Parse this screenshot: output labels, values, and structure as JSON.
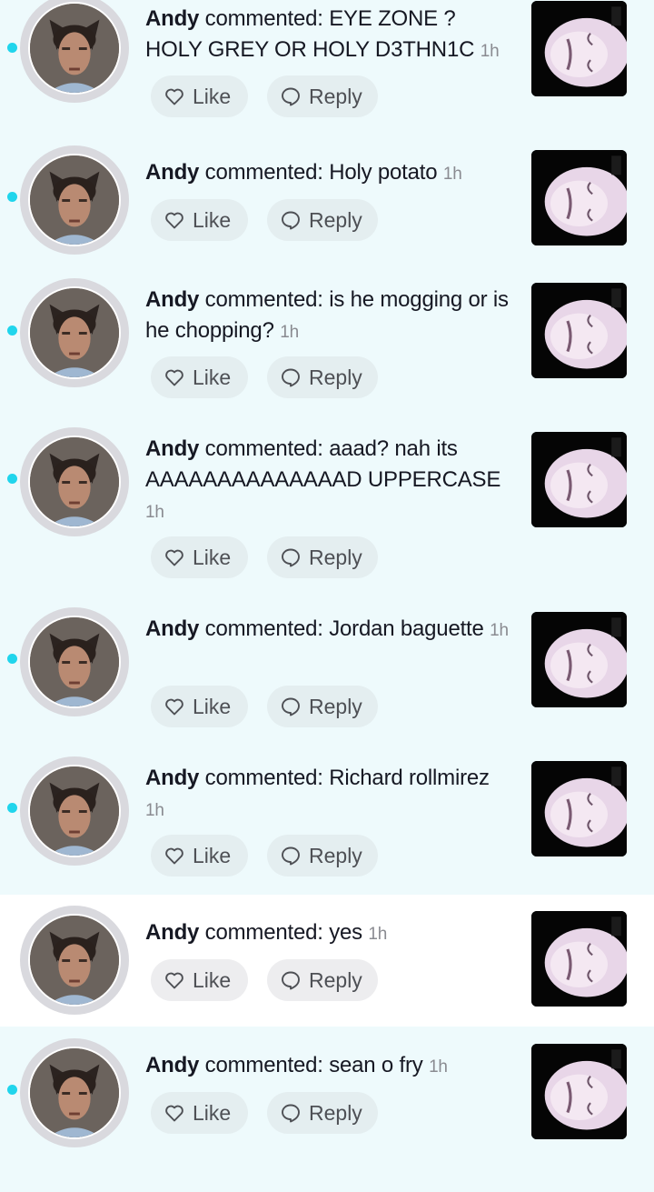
{
  "like_label": "Like",
  "reply_label": "Reply",
  "colors": {
    "unread_bg": "#eefafc",
    "read_bg": "#ffffff",
    "unread_dot": "#20d5ec"
  },
  "icons": {
    "like": "heart-icon",
    "reply": "speech-bubble-icon"
  },
  "notifications": [
    {
      "user": "Andy",
      "verb": "commented:",
      "comment": "EYE ZONE ? HOLY GREY OR HOLY D3THN1C",
      "time": "1h",
      "unread": true
    },
    {
      "user": "Andy",
      "verb": "commented:",
      "comment": "Holy potato",
      "time": "1h",
      "unread": true
    },
    {
      "user": "Andy",
      "verb": "commented:",
      "comment": "is he mogging or is he chopping?",
      "time": "1h",
      "unread": true
    },
    {
      "user": "Andy",
      "verb": "commented:",
      "comment": "aaad? nah its AAAAAAAAAAAAAAD UPPERCASE",
      "time": "1h",
      "unread": true
    },
    {
      "user": "Andy",
      "verb": "commented:",
      "comment": "Jordan baguette",
      "time": "1h",
      "unread": true
    },
    {
      "user": "Andy",
      "verb": "commented:",
      "comment": "Richard rollmirez",
      "time": "1h",
      "unread": true
    },
    {
      "user": "Andy",
      "verb": "commented:",
      "comment": "yes",
      "time": "1h",
      "unread": false
    },
    {
      "user": "Andy",
      "verb": "commented:",
      "comment": "sean o fry",
      "time": "1h",
      "unread": true
    }
  ]
}
